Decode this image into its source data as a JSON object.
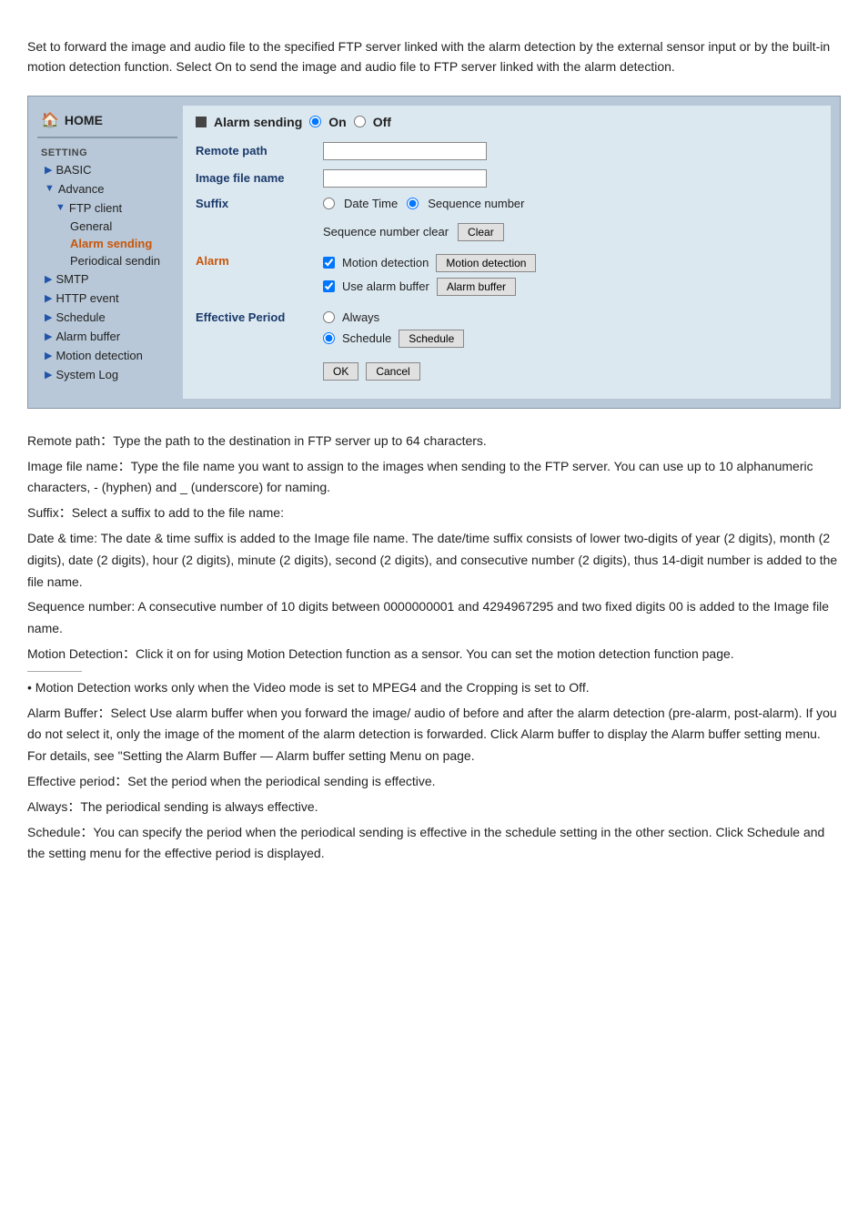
{
  "intro": {
    "text": "Set to forward the image and audio file to the specified FTP server linked with the alarm detection by the external sensor input or by the built-in motion detection function. Select On to send the image and audio file to FTP server linked with the alarm detection."
  },
  "sidebar": {
    "home_label": "HOME",
    "setting_label": "SETTING",
    "items": [
      {
        "id": "basic",
        "label": "BASIC",
        "arrow": true
      },
      {
        "id": "advance",
        "label": "Advance",
        "arrow": true,
        "expanded": true
      },
      {
        "id": "ftp-client",
        "label": "FTP client",
        "arrow": true,
        "sub": true,
        "expanded": true
      },
      {
        "id": "general",
        "label": "General",
        "sub2": true
      },
      {
        "id": "alarm-sending",
        "label": "Alarm sending",
        "sub2": true,
        "active": true
      },
      {
        "id": "periodical-sendin",
        "label": "Periodical sendin",
        "sub2": true
      },
      {
        "id": "smtp",
        "label": "SMTP",
        "arrow": true
      },
      {
        "id": "http-event",
        "label": "HTTP event",
        "arrow": true
      },
      {
        "id": "schedule",
        "label": "Schedule",
        "arrow": true
      },
      {
        "id": "alarm-buffer",
        "label": "Alarm buffer",
        "arrow": true
      },
      {
        "id": "motion-detection",
        "label": "Motion detection",
        "arrow": true
      },
      {
        "id": "system-log",
        "label": "System Log",
        "arrow": true
      }
    ]
  },
  "main": {
    "alarm_sending_label": "Alarm sending",
    "on_label": "On",
    "off_label": "Off",
    "remote_path_label": "Remote path",
    "image_file_name_label": "Image file name",
    "suffix_label": "Suffix",
    "date_time_label": "Date Time",
    "sequence_number_label": "Sequence number",
    "seq_number_clear_label": "Sequence number clear",
    "clear_btn_label": "Clear",
    "alarm_label": "Alarm",
    "motion_detection_label": "Motion detection",
    "motion_detection_btn_label": "Motion detection",
    "use_alarm_buffer_label": "Use alarm buffer",
    "alarm_buffer_btn_label": "Alarm buffer",
    "effective_period_label": "Effective Period",
    "always_label": "Always",
    "schedule_label": "Schedule",
    "schedule_btn_label": "Schedule",
    "ok_btn_label": "OK",
    "cancel_btn_label": "Cancel"
  },
  "descriptions": [
    "Remote path：Type the path to the destination in FTP server up to 64 characters.",
    "Image file name：Type the file name you want to assign to the images when sending to the FTP server. You can use up to 10 alphanumeric characters, - (hyphen) and _ (underscore) for naming.",
    "Suffix：Select a suffix to add to the file name:",
    "Date & time: The date & time suffix is added to the Image file name. The date/time suffix consists of lower two-digits of year (2 digits), month (2 digits), date (2 digits), hour (2 digits), minute (2 digits), second (2 digits), and consecutive number (2 digits), thus 14-digit number is added to the file name.",
    "Sequence number: A consecutive number of 10 digits between 0000000001 and 4294967295 and two fixed digits 00 is added to the Image file name.",
    "Motion Detection：Click it on for using Motion Detection function as a sensor. You can set the motion detection function page.",
    "• Motion Detection works only when the Video mode is set to MPEG4 and the Cropping is set to Off.",
    "Alarm Buffer：Select Use alarm buffer when you forward the image/ audio of before and after the alarm detection (pre-alarm, post-alarm). If you do not select it, only the image of the moment of the alarm detection is forwarded. Click Alarm buffer to display the Alarm buffer setting menu. For details, see \"Setting the Alarm Buffer — Alarm buffer setting Menu on page.",
    "Effective period：Set the period when the periodical sending is effective.",
    "Always：The periodical sending is always effective.",
    "Schedule：You can specify the period when the periodical sending is effective in the schedule setting in the other section. Click Schedule and the setting menu for the effective period is displayed."
  ]
}
